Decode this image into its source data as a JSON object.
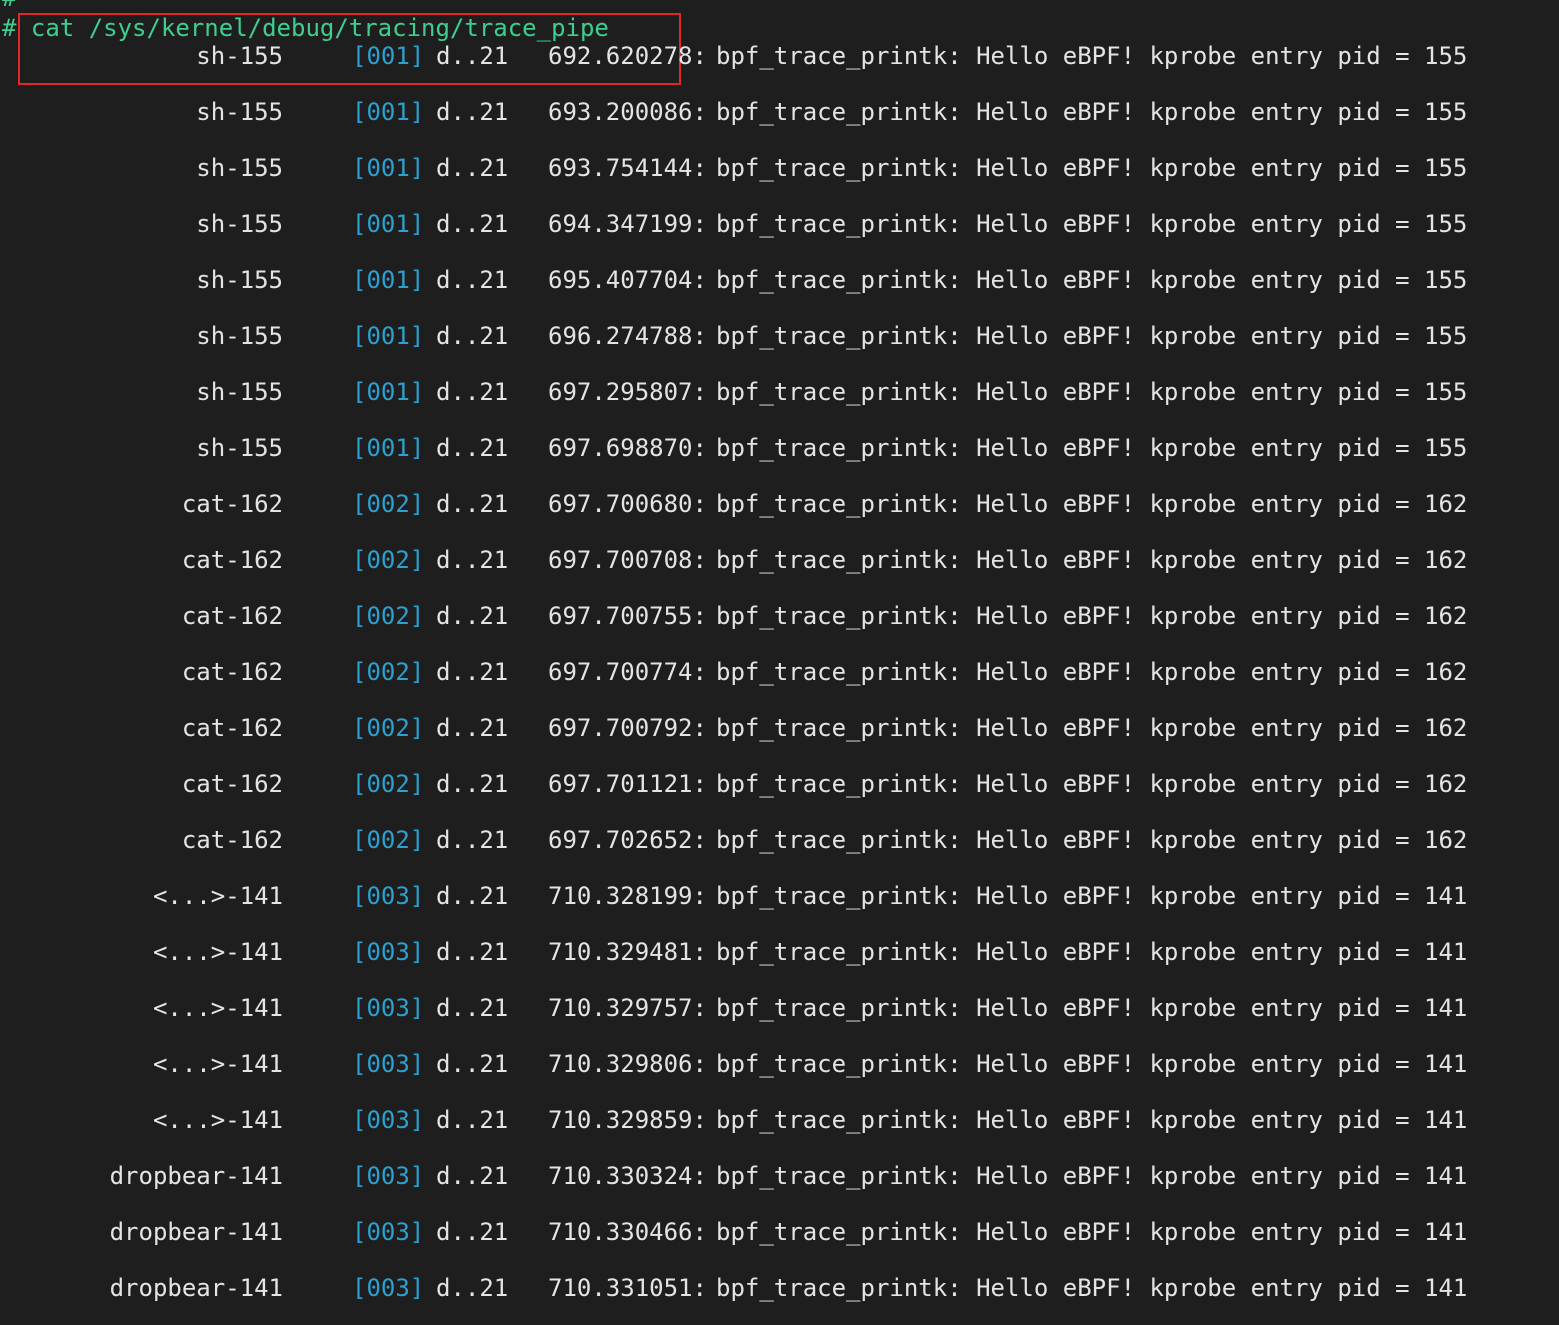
{
  "prompt": {
    "top_hash": "#",
    "hash": "#",
    "command": " cat /sys/kernel/debug/tracing/trace_pipe"
  },
  "colors": {
    "background": "#1e1e1e",
    "prompt": "#3ecf8e",
    "cpu": "#2f9fcf",
    "text": "#e4e4e4",
    "highlight_box": "#e0252b"
  },
  "rows": [
    {
      "task": "sh-155",
      "cpu": "[001]",
      "flags": "d..21",
      "ts": "692.620278:",
      "msg": "bpf_trace_printk: Hello eBPF! kprobe entry pid = 155"
    },
    {
      "task": "sh-155",
      "cpu": "[001]",
      "flags": "d..21",
      "ts": "693.200086:",
      "msg": "bpf_trace_printk: Hello eBPF! kprobe entry pid = 155"
    },
    {
      "task": "sh-155",
      "cpu": "[001]",
      "flags": "d..21",
      "ts": "693.754144:",
      "msg": "bpf_trace_printk: Hello eBPF! kprobe entry pid = 155"
    },
    {
      "task": "sh-155",
      "cpu": "[001]",
      "flags": "d..21",
      "ts": "694.347199:",
      "msg": "bpf_trace_printk: Hello eBPF! kprobe entry pid = 155"
    },
    {
      "task": "sh-155",
      "cpu": "[001]",
      "flags": "d..21",
      "ts": "695.407704:",
      "msg": "bpf_trace_printk: Hello eBPF! kprobe entry pid = 155"
    },
    {
      "task": "sh-155",
      "cpu": "[001]",
      "flags": "d..21",
      "ts": "696.274788:",
      "msg": "bpf_trace_printk: Hello eBPF! kprobe entry pid = 155"
    },
    {
      "task": "sh-155",
      "cpu": "[001]",
      "flags": "d..21",
      "ts": "697.295807:",
      "msg": "bpf_trace_printk: Hello eBPF! kprobe entry pid = 155"
    },
    {
      "task": "sh-155",
      "cpu": "[001]",
      "flags": "d..21",
      "ts": "697.698870:",
      "msg": "bpf_trace_printk: Hello eBPF! kprobe entry pid = 155"
    },
    {
      "task": "cat-162",
      "cpu": "[002]",
      "flags": "d..21",
      "ts": "697.700680:",
      "msg": "bpf_trace_printk: Hello eBPF! kprobe entry pid = 162"
    },
    {
      "task": "cat-162",
      "cpu": "[002]",
      "flags": "d..21",
      "ts": "697.700708:",
      "msg": "bpf_trace_printk: Hello eBPF! kprobe entry pid = 162"
    },
    {
      "task": "cat-162",
      "cpu": "[002]",
      "flags": "d..21",
      "ts": "697.700755:",
      "msg": "bpf_trace_printk: Hello eBPF! kprobe entry pid = 162"
    },
    {
      "task": "cat-162",
      "cpu": "[002]",
      "flags": "d..21",
      "ts": "697.700774:",
      "msg": "bpf_trace_printk: Hello eBPF! kprobe entry pid = 162"
    },
    {
      "task": "cat-162",
      "cpu": "[002]",
      "flags": "d..21",
      "ts": "697.700792:",
      "msg": "bpf_trace_printk: Hello eBPF! kprobe entry pid = 162"
    },
    {
      "task": "cat-162",
      "cpu": "[002]",
      "flags": "d..21",
      "ts": "697.701121:",
      "msg": "bpf_trace_printk: Hello eBPF! kprobe entry pid = 162"
    },
    {
      "task": "cat-162",
      "cpu": "[002]",
      "flags": "d..21",
      "ts": "697.702652:",
      "msg": "bpf_trace_printk: Hello eBPF! kprobe entry pid = 162"
    },
    {
      "task": "<...>-141",
      "cpu": "[003]",
      "flags": "d..21",
      "ts": "710.328199:",
      "msg": "bpf_trace_printk: Hello eBPF! kprobe entry pid = 141"
    },
    {
      "task": "<...>-141",
      "cpu": "[003]",
      "flags": "d..21",
      "ts": "710.329481:",
      "msg": "bpf_trace_printk: Hello eBPF! kprobe entry pid = 141"
    },
    {
      "task": "<...>-141",
      "cpu": "[003]",
      "flags": "d..21",
      "ts": "710.329757:",
      "msg": "bpf_trace_printk: Hello eBPF! kprobe entry pid = 141"
    },
    {
      "task": "<...>-141",
      "cpu": "[003]",
      "flags": "d..21",
      "ts": "710.329806:",
      "msg": "bpf_trace_printk: Hello eBPF! kprobe entry pid = 141"
    },
    {
      "task": "<...>-141",
      "cpu": "[003]",
      "flags": "d..21",
      "ts": "710.329859:",
      "msg": "bpf_trace_printk: Hello eBPF! kprobe entry pid = 141"
    },
    {
      "task": "dropbear-141",
      "cpu": "[003]",
      "flags": "d..21",
      "ts": "710.330324:",
      "msg": "bpf_trace_printk: Hello eBPF! kprobe entry pid = 141"
    },
    {
      "task": "dropbear-141",
      "cpu": "[003]",
      "flags": "d..21",
      "ts": "710.330466:",
      "msg": "bpf_trace_printk: Hello eBPF! kprobe entry pid = 141"
    },
    {
      "task": "dropbear-141",
      "cpu": "[003]",
      "flags": "d..21",
      "ts": "710.331051:",
      "msg": "bpf_trace_printk: Hello eBPF! kprobe entry pid = 141"
    }
  ]
}
